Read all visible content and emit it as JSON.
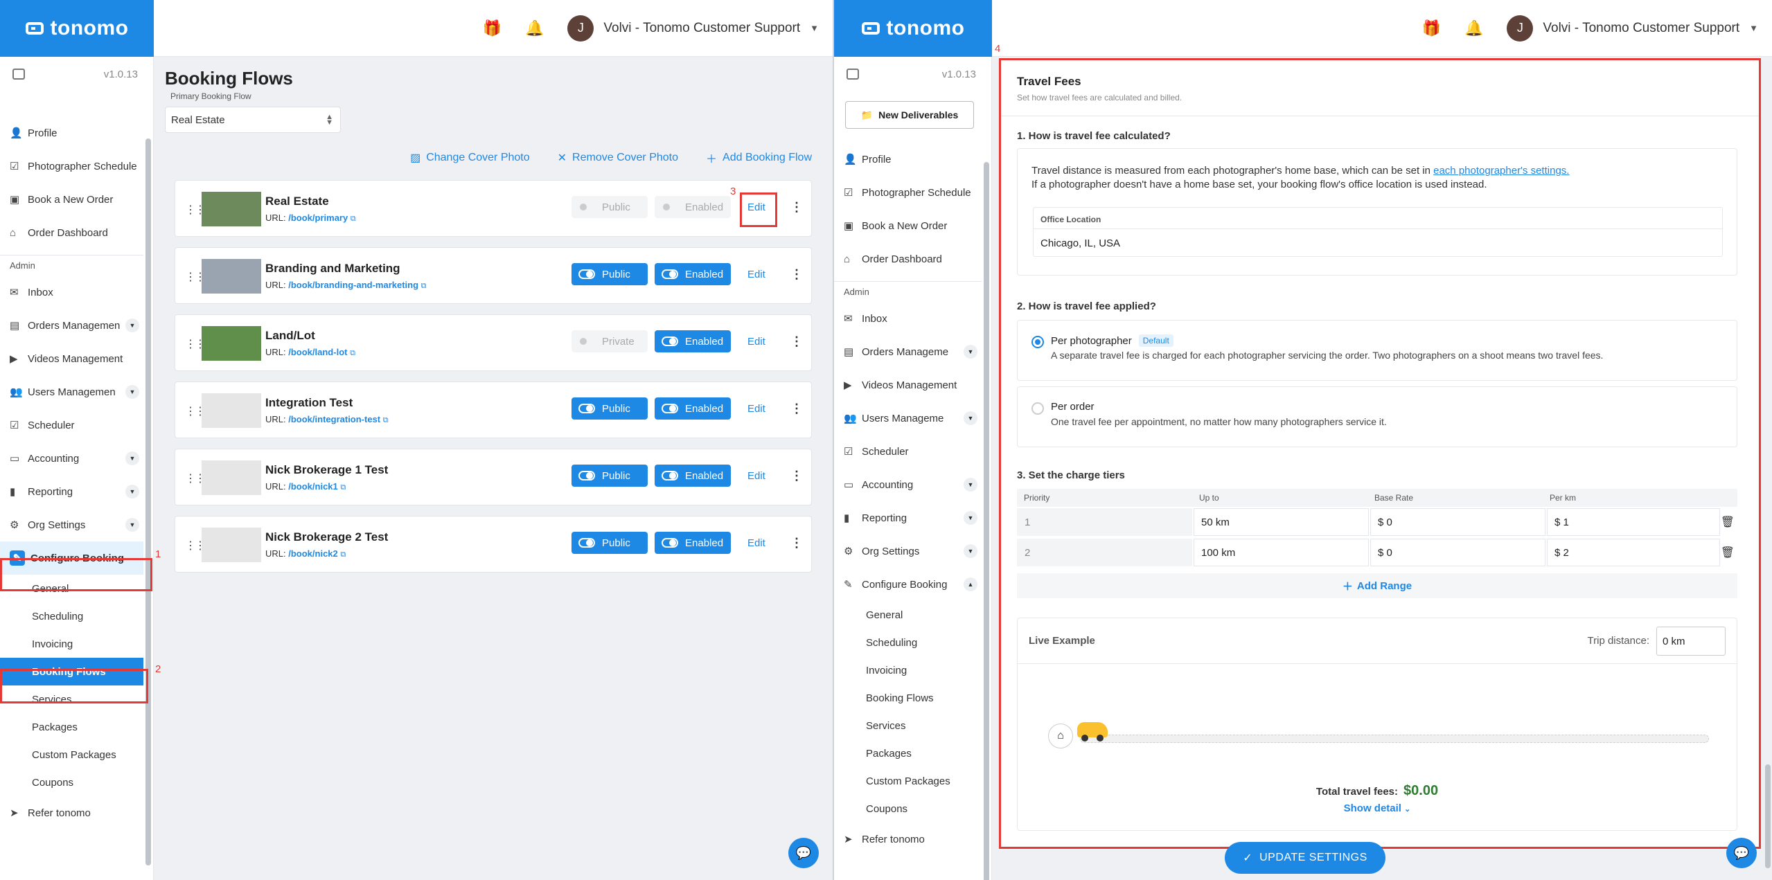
{
  "left": {
    "logo": "tonomo",
    "version": "v1.0.13",
    "user_initial": "J",
    "user_name": "Volvi - Tonomo Customer Support",
    "nav": {
      "profile": "Profile",
      "photographer_schedule": "Photographer Schedule",
      "book_new_order": "Book a New Order",
      "order_dashboard": "Order Dashboard",
      "admin": "Admin",
      "inbox": "Inbox",
      "orders_management": "Orders Managemen",
      "videos_management": "Videos Management",
      "users_management": "Users Managemen",
      "scheduler": "Scheduler",
      "accounting": "Accounting",
      "reporting": "Reporting",
      "org_settings": "Org Settings",
      "configure_booking": "Configure Booking",
      "general": "General",
      "scheduling": "Scheduling",
      "invoicing": "Invoicing",
      "booking_flows": "Booking Flows",
      "services": "Services",
      "packages": "Packages",
      "custom_packages": "Custom Packages",
      "coupons": "Coupons",
      "refer": "Refer tonomo"
    },
    "title": "Booking Flows",
    "primary_label": "Primary Booking Flow",
    "primary_value": "Real Estate",
    "actions": {
      "change_cover": "Change Cover Photo",
      "remove_cover": "Remove Cover Photo",
      "add_flow": "Add Booking Flow"
    },
    "flows": [
      {
        "name": "Real Estate",
        "url_prefix": "URL:",
        "url": "/book/primary",
        "visibility": "Public",
        "status": "Enabled",
        "edit": "Edit"
      },
      {
        "name": "Branding and Marketing",
        "url_prefix": "URL:",
        "url": "/book/branding-and-marketing",
        "visibility": "Public",
        "status": "Enabled",
        "edit": "Edit"
      },
      {
        "name": "Land/Lot",
        "url_prefix": "URL:",
        "url": "/book/land-lot",
        "visibility": "Private",
        "status": "Enabled",
        "edit": "Edit"
      },
      {
        "name": "Integration Test",
        "url_prefix": "URL:",
        "url": "/book/integration-test",
        "visibility": "Public",
        "status": "Enabled",
        "edit": "Edit"
      },
      {
        "name": "Nick Brokerage 1 Test",
        "url_prefix": "URL:",
        "url": "/book/nick1",
        "visibility": "Public",
        "status": "Enabled",
        "edit": "Edit"
      },
      {
        "name": "Nick Brokerage 2 Test",
        "url_prefix": "URL:",
        "url": "/book/nick2",
        "visibility": "Public",
        "status": "Enabled",
        "edit": "Edit"
      }
    ],
    "annotations": {
      "a1": "1",
      "a2": "2",
      "a3": "3"
    }
  },
  "right": {
    "logo": "tonomo",
    "version": "v1.0.13",
    "user_initial": "J",
    "user_name": "Volvi - Tonomo Customer Support",
    "new_deliverables": "New Deliverables",
    "nav": {
      "profile": "Profile",
      "photographer_schedule": "Photographer Schedule",
      "book_new_order": "Book a New Order",
      "order_dashboard": "Order Dashboard",
      "admin": "Admin",
      "inbox": "Inbox",
      "orders_management": "Orders Manageme",
      "videos_management": "Videos Management",
      "users_management": "Users Manageme",
      "scheduler": "Scheduler",
      "accounting": "Accounting",
      "reporting": "Reporting",
      "org_settings": "Org Settings",
      "configure_booking": "Configure Booking",
      "general": "General",
      "scheduling": "Scheduling",
      "invoicing": "Invoicing",
      "booking_flows": "Booking Flows",
      "services": "Services",
      "packages": "Packages",
      "custom_packages": "Custom Packages",
      "coupons": "Coupons",
      "refer": "Refer tonomo"
    },
    "annotation": "4",
    "travel": {
      "title": "Travel Fees",
      "subtitle": "Set how travel fees are calculated and billed.",
      "q1": "1. How is travel fee calculated?",
      "q1_text_a": "Travel distance is measured from each photographer's home base, which can be set in",
      "q1_link": "each photographer's settings.",
      "q1_text_b": "If a photographer doesn't have a home base set, your booking flow's office location is used instead.",
      "office_label": "Office Location",
      "office_value": "Chicago, IL, USA",
      "q2": "2. How is travel fee applied?",
      "opt1_title": "Per photographer",
      "opt1_badge": "Default",
      "opt1_desc": "A separate travel fee is charged for each photographer servicing the order. Two photographers on a shoot means two travel fees.",
      "opt2_title": "Per order",
      "opt2_desc": "One travel fee per appointment, no matter how many photographers service it.",
      "q3": "3. Set the charge tiers",
      "cols": [
        "Priority",
        "Up to",
        "Base Rate",
        "Per km"
      ],
      "tiers": [
        {
          "priority": "1",
          "upto": "50 km",
          "base": "$ 0",
          "perkm": "$ 1"
        },
        {
          "priority": "2",
          "upto": "100 km",
          "base": "$ 0",
          "perkm": "$ 2"
        }
      ],
      "add_range": "Add Range",
      "live_example": "Live Example",
      "trip_label": "Trip distance:",
      "trip_value": "0 km",
      "total_label": "Total travel fees:",
      "total_value": "$0.00",
      "show_detail": "Show detail"
    },
    "update": "UPDATE SETTINGS"
  }
}
